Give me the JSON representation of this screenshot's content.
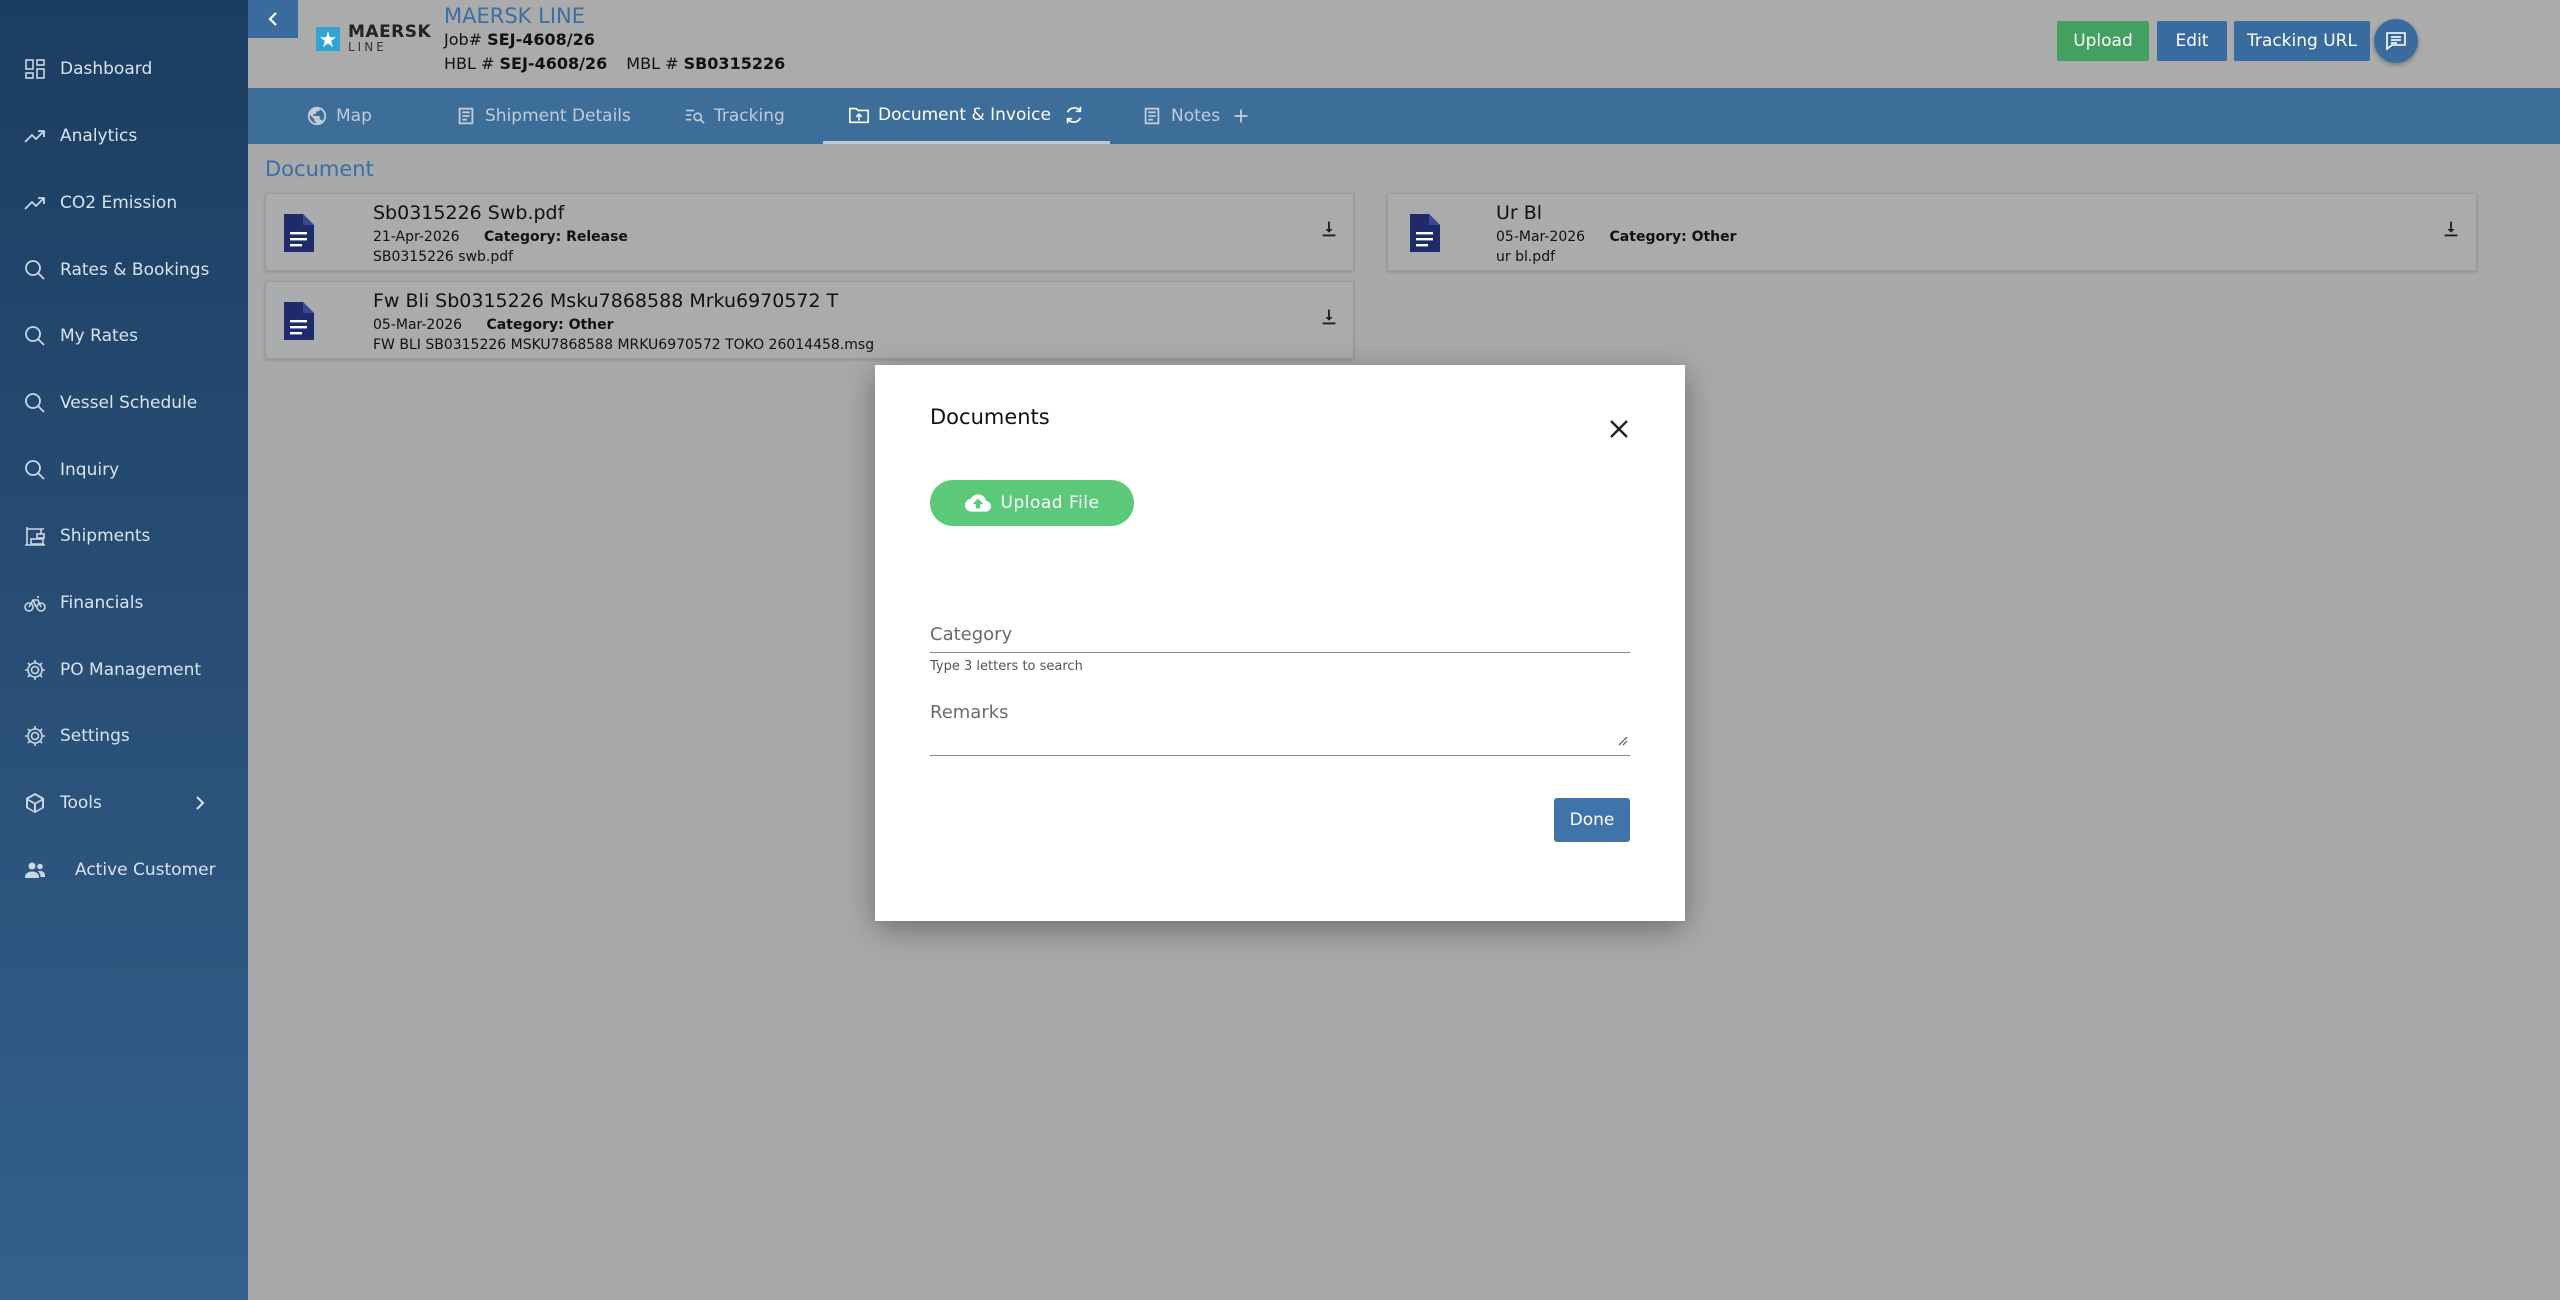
{
  "sidebar": {
    "items": [
      {
        "label": "Dashboard",
        "icon": "dashboard-icon"
      },
      {
        "label": "Analytics",
        "icon": "trending-up-icon"
      },
      {
        "label": "CO2 Emission",
        "icon": "trending-up-icon"
      },
      {
        "label": "Rates & Bookings",
        "icon": "search-icon"
      },
      {
        "label": "My Rates",
        "icon": "search-icon"
      },
      {
        "label": "Vessel Schedule",
        "icon": "search-icon"
      },
      {
        "label": "Inquiry",
        "icon": "search-icon"
      },
      {
        "label": "Shipments",
        "icon": "crane-icon"
      },
      {
        "label": "Financials",
        "icon": "bicycle-icon"
      },
      {
        "label": "PO Management",
        "icon": "gear-icon"
      },
      {
        "label": "Settings",
        "icon": "gear-icon"
      },
      {
        "label": "Tools",
        "icon": "box-icon"
      },
      {
        "label": "Active Customer",
        "icon": "people-icon"
      }
    ]
  },
  "header": {
    "logo_main": "MAERSK",
    "logo_sub": "LINE",
    "carrier": "MAERSK LINE",
    "job_label": "Job#",
    "job_value": "SEJ-4608/26",
    "hbl_label": "HBL #",
    "hbl_value": "SEJ-4608/26",
    "mbl_label": "MBL #",
    "mbl_value": "SB0315226",
    "buttons": {
      "upload": "Upload",
      "edit": "Edit",
      "tracking": "Tracking URL"
    }
  },
  "tabs": [
    {
      "label": "Map"
    },
    {
      "label": "Shipment Details"
    },
    {
      "label": "Tracking"
    },
    {
      "label": "Document & Invoice"
    },
    {
      "label": "Notes"
    }
  ],
  "content": {
    "section_title": "Document",
    "documents": [
      {
        "title": "Sb0315226 Swb.pdf",
        "date": "21-Apr-2026",
        "category": "Category: Release",
        "file": "SB0315226 swb.pdf"
      },
      {
        "title": "Fw Bli Sb0315226 Msku7868588 Mrku6970572 T",
        "date": "05-Mar-2026",
        "category": "Category: Other",
        "file": "FW BLI SB0315226 MSKU7868588 MRKU6970572 TOKO 26014458.msg"
      },
      {
        "title": "Ur Bl",
        "date": "05-Mar-2026",
        "category": "Category: Other",
        "file": "ur bl.pdf"
      }
    ]
  },
  "modal": {
    "title": "Documents",
    "upload_label": "Upload File",
    "category_placeholder": "Category",
    "category_value": "",
    "category_hint": "Type 3 letters to search",
    "remarks_placeholder": "Remarks",
    "remarks_value": "",
    "done_label": "Done"
  },
  "colors": {
    "sidebar_top": "#1b3d61",
    "accent_blue": "#3a6b9e",
    "upload_green": "#43a060",
    "upload_file_green": "#5cc97a",
    "doc_icon": "#1f2a6b"
  }
}
